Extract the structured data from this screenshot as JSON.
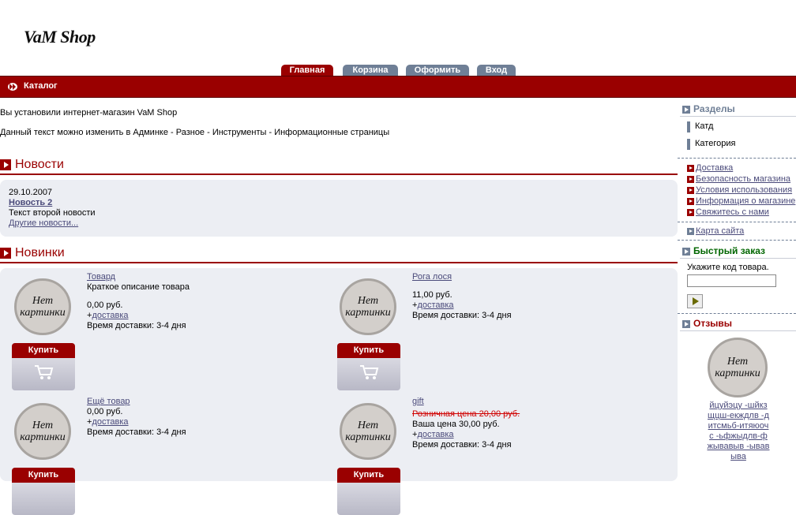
{
  "header": {
    "logo": "VaM Shop"
  },
  "tabs": [
    {
      "label": "Главная",
      "active": true
    },
    {
      "label": "Корзина",
      "active": false
    },
    {
      "label": "Оформить",
      "active": false
    },
    {
      "label": "Вход",
      "active": false
    }
  ],
  "catalog_bar": {
    "label": "Каталог"
  },
  "intro": {
    "line1": "Вы установили интернет-магазин VaM Shop",
    "line2": "Данный текст можно изменить в Админке - Разное - Инструменты - Информационные страницы"
  },
  "news": {
    "heading": "Новости",
    "date": "29.10.2007",
    "title": "Новость 2",
    "text": "Текст второй новости",
    "more": "Другие новости..."
  },
  "new_products": {
    "heading": "Новинки",
    "no_image": "Нет картинки",
    "buy_label": "Купить",
    "items": [
      {
        "name": "Товард",
        "desc": "Краткое описание товара",
        "price": "0,00 руб.",
        "old_price": "",
        "delivery_prefix": "+",
        "delivery_link": "доставка",
        "delivery_time": "Время доставки:  3-4 дня"
      },
      {
        "name": "Рога лося",
        "desc": "",
        "price": "11,00 руб.",
        "old_price": "",
        "delivery_prefix": "+",
        "delivery_link": "доставка",
        "delivery_time": "Время доставки:  3-4 дня"
      },
      {
        "name": "Ещё товар",
        "desc": "",
        "price": "0,00 руб.",
        "old_price": "",
        "delivery_prefix": "+",
        "delivery_link": "доставка",
        "delivery_time": "Время доставки:  3-4 дня"
      },
      {
        "name": "gift",
        "desc": "",
        "price": "Ваша цена 30,00 руб.",
        "old_price": "Розничная цена 20,00 руб.",
        "delivery_prefix": "+",
        "delivery_link": "доставка",
        "delivery_time": "Время доставки:  3-4 дня"
      }
    ]
  },
  "sidebar": {
    "sections_title": "Разделы",
    "categories": [
      "Катд",
      "Категория"
    ],
    "info_links": [
      "Доставка",
      "Безопасность магазина",
      "Условия использования",
      "Информация о магазине",
      "Свяжитесь с нами"
    ],
    "sitemap": "Карта сайта",
    "quick_order_title": "Быстрый заказ",
    "quick_order_hint": "Укажите код товара.",
    "quick_order_value": "",
    "reviews_title": "Отзывы",
    "review_text": "йцуйэцу -шйкзщцш-екждлв -дитсмьб-итяюочс -ьфжыдлв-фжывавыв -ывавыва"
  },
  "colors": {
    "accent_red": "#9a0000",
    "tab_inactive": "#6f7f96",
    "quick_order_title": "#006600",
    "reviews_title": "#9a0000",
    "panel_bg": "#eceef3"
  }
}
